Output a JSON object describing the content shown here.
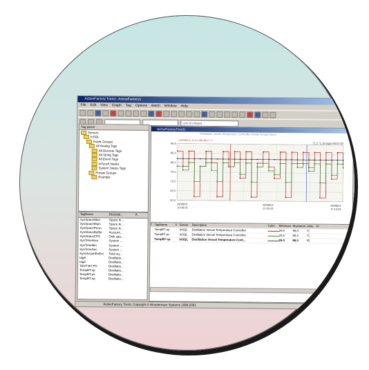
{
  "window": {
    "title": "ActiveFactory Trend - ActiveFactory1"
  },
  "menu": [
    "File",
    "Edit",
    "View",
    "Graph",
    "Tag",
    "Options",
    "Batch",
    "Window",
    "Help"
  ],
  "toolbar2": {
    "duration": "Last 15 minutes"
  },
  "tree": {
    "header": "Tag picker",
    "items": [
      "Servers",
      "InSQL",
      "Public Groups",
      "All Analog Tags",
      "All Discrete Tags",
      "All String Tags",
      "All Event Tags",
      "InTouch Nodes",
      "System Status Tags",
      "Private Groups",
      "Example"
    ]
  },
  "taglist": {
    "columns": [
      "TagName",
      "Descript...",
      "A"
    ],
    "rows": [
      [
        "SysSpaceAlter",
        "Space le..."
      ],
      [
        "SysSpaceMain",
        "Space le..."
      ],
      [
        "SysSpacePerm",
        "Space le..."
      ],
      [
        "SysStatusBuffer",
        "Account..."
      ],
      [
        "SysStatusCPS",
        "Disk spa..."
      ],
      [
        "SysTimeHour",
        "System ..."
      ],
      [
        "SysTimeMin",
        "System ..."
      ],
      [
        "SysTimeSec",
        "System ..."
      ],
      [
        "SysVersionEvEnt",
        "Total sq..."
      ],
      [
        "tagA",
        "Distillatio..."
      ],
      [
        "tagZ",
        "Distillatio..."
      ],
      [
        "TEST-BT-PV",
        "Distillatio..."
      ],
      [
        "TempBT-sp",
        "Distillatio..."
      ],
      [
        "TempBT-pv",
        "Distillatio..."
      ],
      [
        "TempBT-op",
        "Distillatio..."
      ]
    ]
  },
  "trend": {
    "title": "ActiveFactoryTrend1",
    "legend1": "Distillation Vessel Temperature Controller (Inside Temperature)",
    "legend2": "(28/08/01 11:21:48) 80.0 °C",
    "legend3": "(28/08/01 11:36:50) 70.0 °C",
    "legend4": "71.2 °C (6 tags) 08:07:00",
    "right_label": "Cycle",
    "x_labels": [
      [
        "28/08/01",
        "10:08:02"
      ],
      [
        "28/08/01",
        "11:05:02"
      ],
      [
        "28/08/01",
        "11:13:02"
      ]
    ]
  },
  "chart_data": {
    "type": "line",
    "ylim": [
      60,
      90
    ],
    "y_ticks": [
      "90.0",
      "85.0",
      "80.0",
      "75.0",
      "70.0",
      "65.0",
      "60.0"
    ],
    "series": [
      {
        "name": "TempBT-op",
        "color": "#cc2020",
        "values": [
          86,
          78,
          86,
          62,
          78,
          86,
          80,
          62,
          86,
          78,
          86,
          72,
          86,
          62,
          80,
          86,
          78,
          72,
          86,
          62,
          86,
          80,
          86,
          78,
          86,
          62,
          86,
          72,
          86,
          80
        ]
      },
      {
        "name": "TempBT-pv",
        "color": "#3a8a3a",
        "values": [
          78,
          76,
          80,
          70,
          78,
          80,
          76,
          70,
          80,
          78,
          80,
          74,
          80,
          70,
          78,
          80,
          76,
          74,
          80,
          70,
          80,
          78,
          80,
          76,
          80,
          70,
          80,
          74,
          80,
          78
        ]
      },
      {
        "name": "TempBT-sp",
        "color": "#444444",
        "values": [
          82,
          82,
          82,
          82,
          82,
          82,
          82,
          82,
          82,
          82,
          82,
          82,
          82,
          82,
          82,
          82,
          82,
          82,
          82,
          82,
          82,
          82,
          82,
          82,
          82,
          82,
          82,
          82,
          82,
          82
        ]
      }
    ]
  },
  "grid": {
    "columns": [
      "T",
      "TagName",
      "V",
      "Server",
      "Description",
      "Color",
      "Minimum",
      "Maximum",
      "Units",
      "Pr"
    ],
    "rows": [
      [
        "TempBT-op",
        "InSQL",
        "Distillation Vessel Temperature Controller",
        "20.0",
        "99.0",
        "°C"
      ],
      [
        "TempBT-pv",
        "InSQL",
        "Distillation Vessel Temperature Controller",
        "20.0",
        "99.0",
        "°C"
      ],
      [
        "TempBT-sp",
        "InSQL",
        "Distillation Vessel Temperature Cont...",
        "20.0",
        "99.0",
        "°C"
      ]
    ]
  },
  "status": {
    "text": "ActiveFactory Trend, Copyright © Wonderware Systems 1999-2001"
  }
}
